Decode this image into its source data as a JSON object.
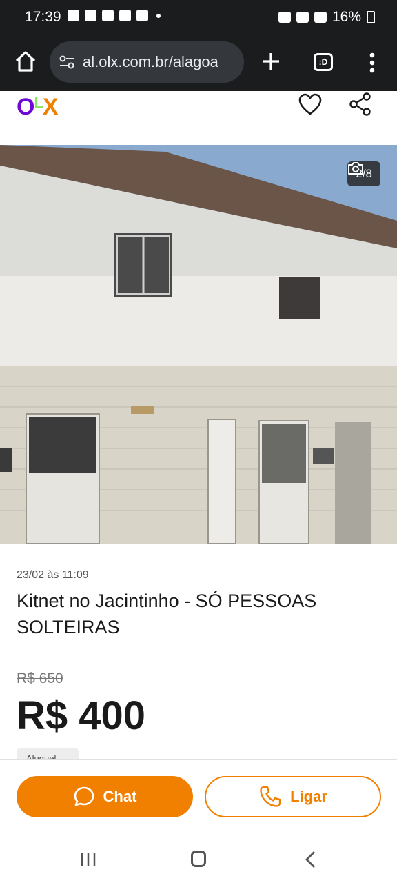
{
  "status_bar": {
    "time": "17:39",
    "battery": "16%"
  },
  "browser": {
    "url": "al.olx.com.br/alagoa",
    "tabs_label": ":D"
  },
  "logo": {
    "o": "O",
    "l": "L",
    "x": "X"
  },
  "photo": {
    "counter": "2/8"
  },
  "listing": {
    "date": "23/02 às 11:09",
    "title": "Kitnet no Jacintinho - SÓ PESSOAS SOLTEIRAS",
    "old_price": "R$ 650",
    "price": "R$ 400",
    "chip": "Aluguel"
  },
  "actions": {
    "chat": "Chat",
    "call": "Ligar"
  },
  "colors": {
    "accent": "#f28000",
    "purple": "#6e0ad6",
    "green": "#8ce563"
  }
}
